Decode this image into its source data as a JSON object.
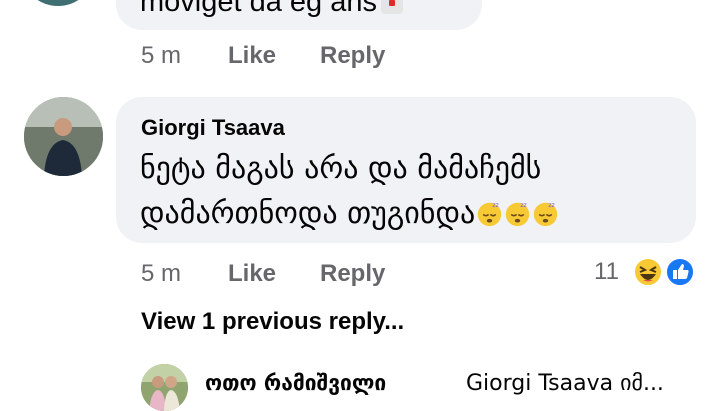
{
  "top_comment": {
    "text": "moviget da eg ans",
    "time": "5 m",
    "like_label": "Like",
    "reply_label": "Reply"
  },
  "comment": {
    "author": "Giorgi Tsaava",
    "text": "ნეტა მაგას არა და მამაჩემს დამართნოდა თუგინდა",
    "emojis": [
      "sleepy-face-icon",
      "sleepy-face-icon",
      "sleepy-face-icon"
    ],
    "time": "5 m",
    "like_label": "Like",
    "reply_label": "Reply",
    "reaction_count": "11",
    "reactions": [
      "haha-icon",
      "like-icon"
    ]
  },
  "view_replies_label": "View 1 previous reply...",
  "reply": {
    "author": "ოთო რამიშვილი",
    "preview": "Giorgi Tsaava იმ..."
  },
  "colors": {
    "bubble": "#f0f2f5",
    "secondary_text": "#65676b",
    "like_blue": "#1877f2",
    "haha_yellow": "#f7c935"
  }
}
